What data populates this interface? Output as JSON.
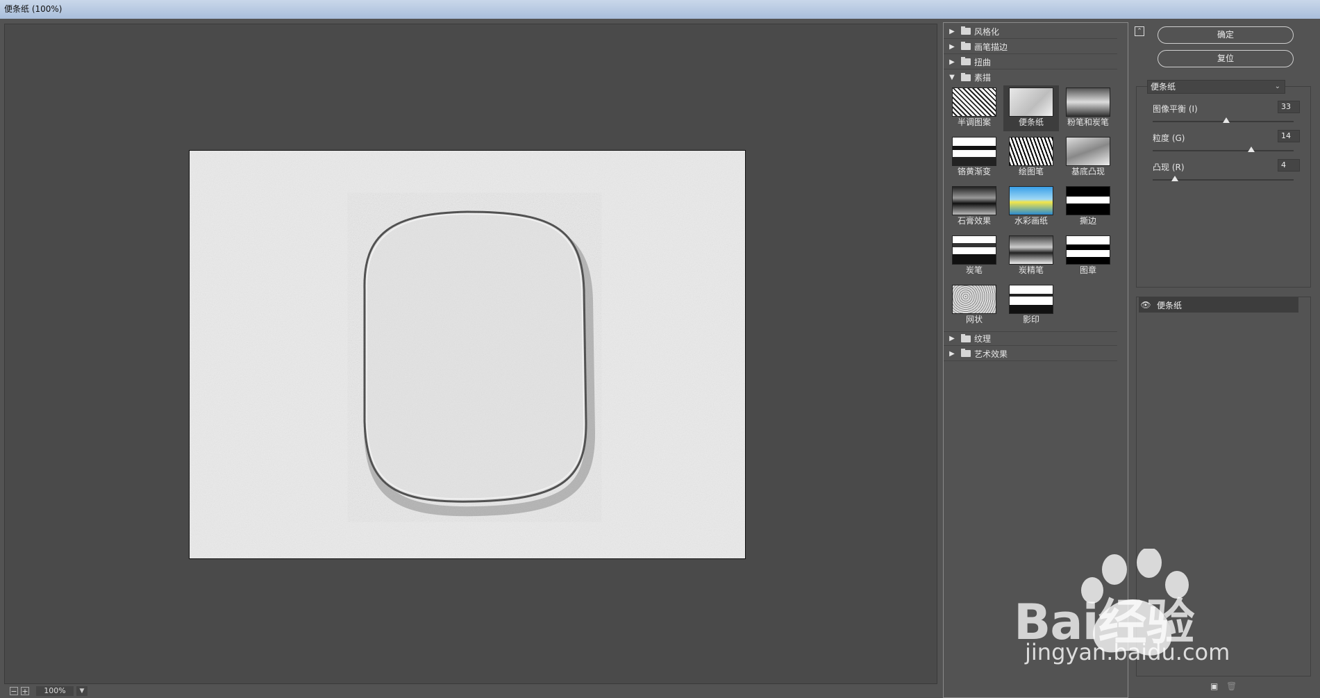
{
  "window": {
    "title": "便条纸 (100%)"
  },
  "preview": {
    "zoom": "100%",
    "zoom_out": "−",
    "zoom_in": "+"
  },
  "gallery": {
    "categories_top": [
      "风格化",
      "画笔描边",
      "扭曲"
    ],
    "open_category": "素描",
    "thumbnails": [
      "半调图案",
      "便条纸",
      "粉笔和炭笔",
      "铬黄渐变",
      "绘图笔",
      "基底凸现",
      "石膏效果",
      "水彩画纸",
      "撕边",
      "炭笔",
      "炭精笔",
      "图章",
      "网状",
      "影印"
    ],
    "selected": "便条纸",
    "categories_bottom": [
      "纹理",
      "艺术效果"
    ]
  },
  "controls": {
    "ok_label": "确定",
    "reset_label": "复位",
    "filter_selected": "便条纸",
    "params": [
      {
        "label": "图像平衡 (I)",
        "value": "33",
        "fraction": 0.52
      },
      {
        "label": "粒度 (G)",
        "value": "14",
        "fraction": 0.7
      },
      {
        "label": "凸现 (R)",
        "value": "4",
        "fraction": 0.16
      }
    ]
  },
  "layers": {
    "items": [
      {
        "name": "便条纸",
        "visible": true
      }
    ]
  },
  "watermark": {
    "brand": "Bai经验",
    "url": "jingyan.baidu.com"
  }
}
